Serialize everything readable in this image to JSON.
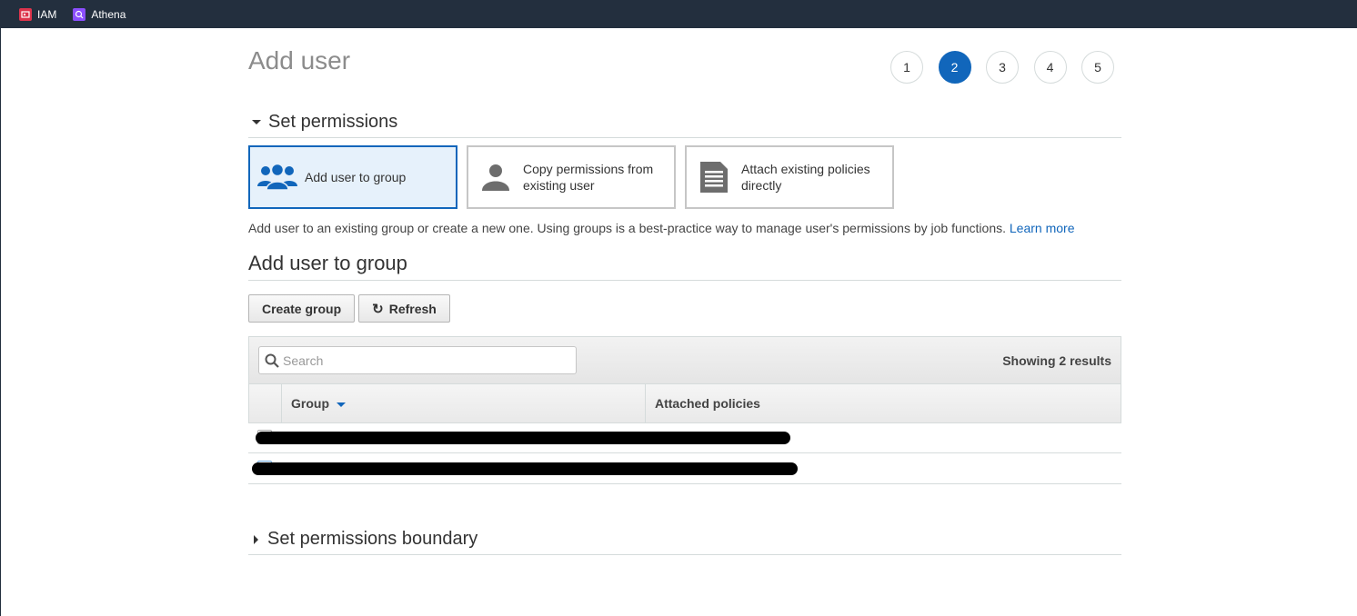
{
  "topbar": {
    "services": [
      {
        "label": "IAM",
        "icon": "iam-icon",
        "color": "#dd344c"
      },
      {
        "label": "Athena",
        "icon": "athena-icon",
        "color": "#8c4fff"
      }
    ]
  },
  "page": {
    "title": "Add user",
    "steps": [
      "1",
      "2",
      "3",
      "4",
      "5"
    ],
    "active_step": "2"
  },
  "permissions": {
    "section_title": "Set permissions",
    "options": [
      {
        "label": "Add user to group",
        "icon": "group-users-icon",
        "selected": true
      },
      {
        "label": "Copy permissions from existing user",
        "icon": "user-icon",
        "selected": false
      },
      {
        "label": "Attach existing policies directly",
        "icon": "document-icon",
        "selected": false
      }
    ],
    "description": "Add user to an existing group or create a new one. Using groups is a best-practice way to manage user's permissions by job functions.",
    "learn_more": "Learn more"
  },
  "group_section": {
    "title": "Add user to group",
    "create_button": "Create group",
    "refresh_button": "Refresh",
    "search_placeholder": "Search",
    "results_text": "Showing 2 results",
    "columns": [
      "Group",
      "Attached policies"
    ],
    "row_count": 2
  },
  "boundary": {
    "section_title": "Set permissions boundary"
  },
  "colors": {
    "accent": "#1166bb",
    "topbar": "#232f3e",
    "selected_bg": "#e6f1fb"
  }
}
